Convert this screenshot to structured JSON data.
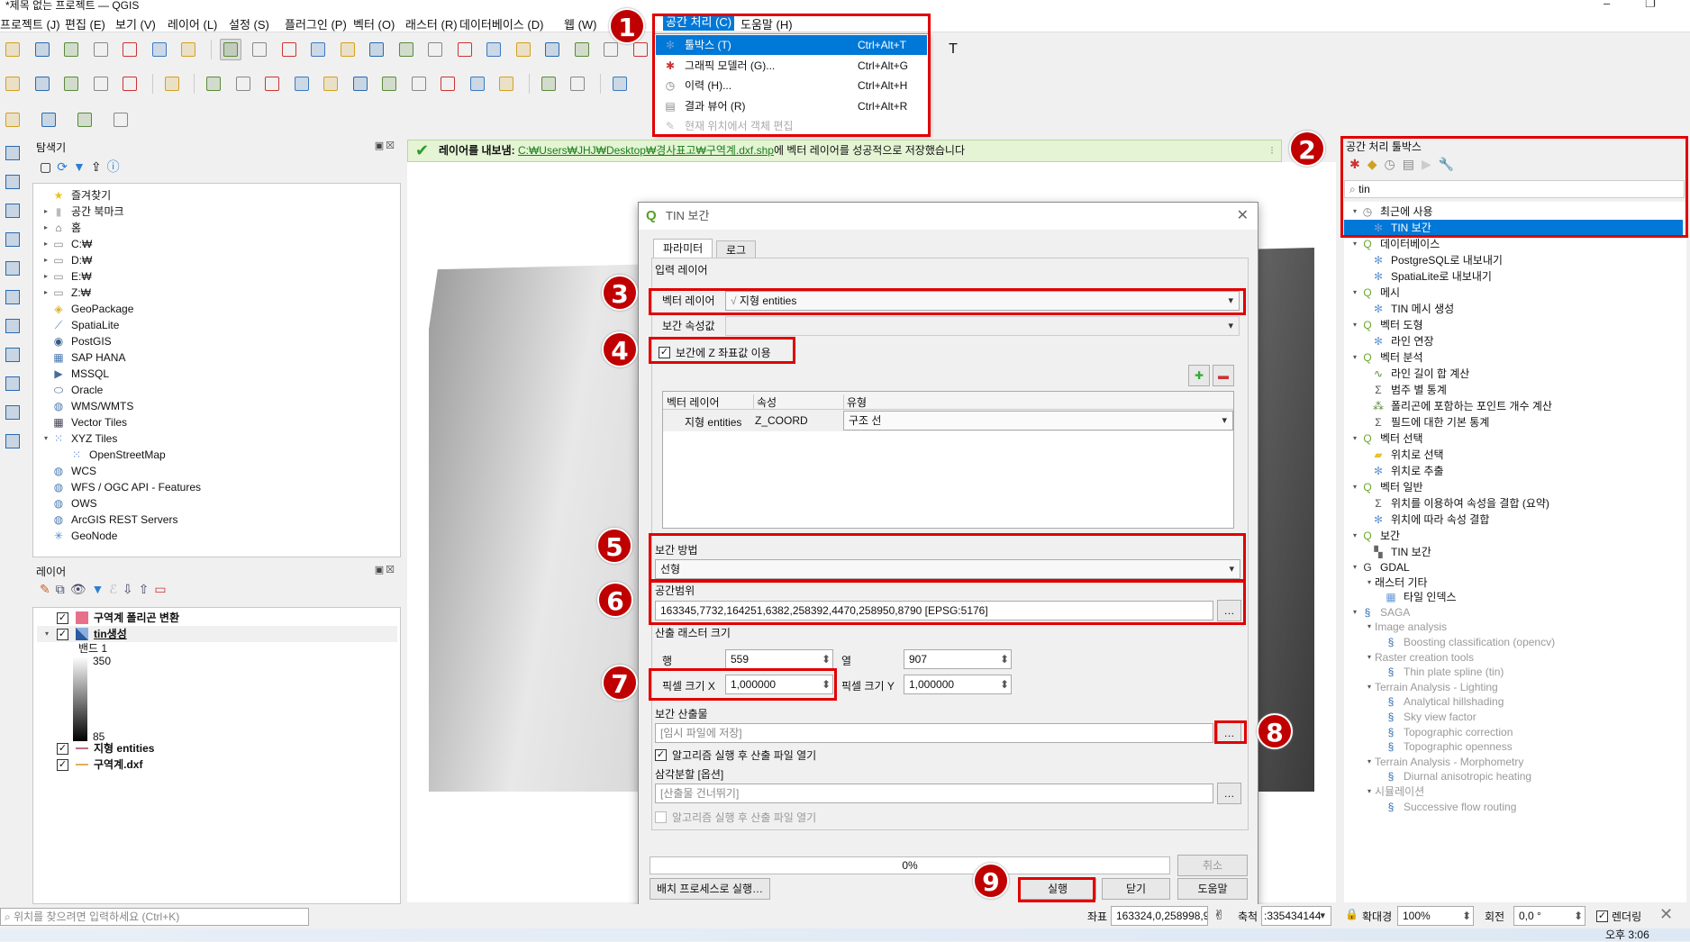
{
  "window": {
    "title": "*제목 없는 프로젝트 — QGIS",
    "minimize": "–",
    "maximize": "❐"
  },
  "menubar": [
    "프로젝트 (J)",
    "편집 (E)",
    "보기 (V)",
    "레이어 (L)",
    "설정 (S)",
    "플러그인 (P)",
    "벡터 (O)",
    "래스터 (R)",
    "데이터베이스 (D)",
    "웹 (W)",
    "공간 처리 (C)",
    "도움말 (H)"
  ],
  "processing_menu": [
    {
      "label": "툴박스 (T)",
      "shortcut": "Ctrl+Alt+T",
      "icon": "gear-icon",
      "state": "selected"
    },
    {
      "label": "그래픽 모델러 (G)...",
      "shortcut": "Ctrl+Alt+G",
      "icon": "model-icon",
      "state": "normal"
    },
    {
      "label": "이력 (H)...",
      "shortcut": "Ctrl+Alt+H",
      "icon": "clock-icon",
      "state": "normal"
    },
    {
      "label": "결과 뷰어 (R)",
      "shortcut": "Ctrl+Alt+R",
      "icon": "document-icon",
      "state": "normal"
    },
    {
      "label": "현재 위치에서 객체 편집",
      "shortcut": "",
      "icon": "edit-icon",
      "state": "disabled"
    }
  ],
  "toolbars": {
    "row1": [
      "new-project",
      "open-project",
      "save-project",
      "save-as",
      "print-layout",
      "layout-manager",
      "style-manager",
      "|",
      "pan",
      "pan-to-selection",
      "zoom-in",
      "zoom-out",
      "zoom-full",
      "zoom-selection",
      "zoom-layer",
      "zoom-native",
      "zoom-last",
      "zoom-next",
      "new-bookmark",
      "show-bookmarks",
      "new-map-view",
      "new-3d-view",
      "temporal-controller",
      "refresh"
    ],
    "row1b": [
      "text-annotation"
    ],
    "row2": [
      "data-source-manager",
      "new-geopackage-layer",
      "new-shapefile-layer",
      "new-spatialite-layer",
      "new-virtual-layer",
      "|",
      "digitize-layer",
      "|",
      "toggle-editing",
      "pencil",
      "save-edits",
      "add-feature",
      "vertex-tool",
      "delete-selected",
      "cut",
      "copy",
      "paste",
      "undo",
      "redo",
      "|",
      "label",
      "pin-label",
      "|",
      "help"
    ],
    "row3": [
      "select-features",
      "open-attribute-table",
      "deselect",
      "select-location"
    ]
  },
  "message_bar": {
    "prefix": "레이어를 내보냄:",
    "link": "C:₩Users₩JHJ₩Desktop₩경사표고₩구역계.dxf.shp",
    "suffix": "에 벡터 레이어를 성공적으로 저장했습니다",
    "status_color": "#2a9d2a"
  },
  "browser": {
    "title": "탐색기",
    "items": [
      {
        "label": "즐겨찾기",
        "icon": "star-icon",
        "arrow": ""
      },
      {
        "label": "공간 북마크",
        "icon": "bookmark-icon",
        "arrow": "▸"
      },
      {
        "label": "홈",
        "icon": "home-folder-icon",
        "arrow": "▸"
      },
      {
        "label": "C:₩",
        "icon": "folder-icon",
        "arrow": "▸"
      },
      {
        "label": "D:₩",
        "icon": "folder-icon",
        "arrow": "▸"
      },
      {
        "label": "E:₩",
        "icon": "folder-icon",
        "arrow": "▸"
      },
      {
        "label": "Z:₩",
        "icon": "folder-icon",
        "arrow": "▸"
      },
      {
        "label": "GeoPackage",
        "icon": "geopackage-icon",
        "arrow": ""
      },
      {
        "label": "SpatiaLite",
        "icon": "spatialite-icon",
        "arrow": ""
      },
      {
        "label": "PostGIS",
        "icon": "postgis-icon",
        "arrow": ""
      },
      {
        "label": "SAP HANA",
        "icon": "hana-icon",
        "arrow": ""
      },
      {
        "label": "MSSQL",
        "icon": "mssql-icon",
        "arrow": ""
      },
      {
        "label": "Oracle",
        "icon": "oracle-icon",
        "arrow": ""
      },
      {
        "label": "WMS/WMTS",
        "icon": "globe-icon",
        "arrow": ""
      },
      {
        "label": "Vector Tiles",
        "icon": "grid-icon",
        "arrow": ""
      },
      {
        "label": "XYZ Tiles",
        "icon": "tiles-icon",
        "arrow": "▾"
      },
      {
        "label": "OpenStreetMap",
        "icon": "tiles-icon",
        "arrow": "",
        "indent": 1
      },
      {
        "label": "WCS",
        "icon": "globe-icon",
        "arrow": ""
      },
      {
        "label": "WFS / OGC API - Features",
        "icon": "globe-icon",
        "arrow": ""
      },
      {
        "label": "OWS",
        "icon": "globe-icon",
        "arrow": ""
      },
      {
        "label": "ArcGIS REST Servers",
        "icon": "globe-icon",
        "arrow": ""
      },
      {
        "label": "GeoNode",
        "icon": "geonode-icon",
        "arrow": ""
      }
    ]
  },
  "layers": {
    "title": "레이어",
    "items": [
      {
        "label": "구역계 폴리곤 변환",
        "checked": true,
        "symbol": "#e8708a",
        "type": "fill"
      },
      {
        "label": "tin생성",
        "checked": true,
        "symbol": "raster",
        "type": "raster",
        "expanded": true
      },
      {
        "label": "지형 entities",
        "checked": true,
        "symbol": "#c07080",
        "type": "line"
      },
      {
        "label": "구역계.dxf",
        "checked": true,
        "symbol": "#e0b060",
        "type": "line"
      }
    ],
    "band_label": "밴드 1",
    "legend_max": "350",
    "legend_min": "85"
  },
  "locator": {
    "placeholder": "위치를 찾으려면 입력하세요 (Ctrl+K)"
  },
  "toolbox": {
    "title": "공간 처리 툴박스",
    "search": "tin",
    "rows": [
      {
        "label": "최근에 사용",
        "level": 0,
        "icon": "clock-icon"
      },
      {
        "label": "TIN 보간",
        "level": 1,
        "icon": "gear-icon",
        "selected": true
      },
      {
        "label": "데이터베이스",
        "level": 0,
        "icon": "qgis-icon"
      },
      {
        "label": "PostgreSQL로 내보내기",
        "level": 1,
        "icon": "gear-icon"
      },
      {
        "label": "SpatiaLite로 내보내기",
        "level": 1,
        "icon": "gear-icon"
      },
      {
        "label": "메시",
        "level": 0,
        "icon": "qgis-icon"
      },
      {
        "label": "TIN 메시 생성",
        "level": 1,
        "icon": "gear-icon"
      },
      {
        "label": "벡터 도형",
        "level": 0,
        "icon": "qgis-icon"
      },
      {
        "label": "라인 연장",
        "level": 1,
        "icon": "gear-icon"
      },
      {
        "label": "벡터 분석",
        "level": 0,
        "icon": "qgis-icon"
      },
      {
        "label": "라인 길이 합 계산",
        "level": 1,
        "icon": "line-length-icon"
      },
      {
        "label": "범주 별 통계",
        "level": 1,
        "icon": "sigma-icon"
      },
      {
        "label": "폴리곤에 포함하는 포인트 개수 계산",
        "level": 1,
        "icon": "count-points-icon"
      },
      {
        "label": "필드에 대한 기본 통계",
        "level": 1,
        "icon": "sigma-icon"
      },
      {
        "label": "벡터 선택",
        "level": 0,
        "icon": "qgis-icon"
      },
      {
        "label": "위치로 선택",
        "level": 1,
        "icon": "select-location-icon"
      },
      {
        "label": "위치로 추출",
        "level": 1,
        "icon": "gear-icon"
      },
      {
        "label": "벡터 일반",
        "level": 0,
        "icon": "qgis-icon"
      },
      {
        "label": "위치를 이용하여 속성을 결합 (요약)",
        "level": 1,
        "icon": "sigma-icon"
      },
      {
        "label": "위치에 따라 속성 결합",
        "level": 1,
        "icon": "gear-icon"
      },
      {
        "label": "보간",
        "level": 0,
        "icon": "qgis-icon"
      },
      {
        "label": "TIN 보간",
        "level": 1,
        "icon": "tin-icon"
      },
      {
        "label": "GDAL",
        "level": 0,
        "icon": "gdal-icon"
      },
      {
        "label": "래스터 기타",
        "level": 1,
        "icon": "",
        "group": true
      },
      {
        "label": "타일 인덱스",
        "level": 2,
        "icon": "tile-index-icon"
      },
      {
        "label": "SAGA",
        "level": 0,
        "icon": "saga-icon",
        "disabled": true
      },
      {
        "label": "Image analysis",
        "level": 1,
        "icon": "",
        "group": true,
        "disabled": true
      },
      {
        "label": "Boosting classification (opencv)",
        "level": 2,
        "icon": "saga-icon",
        "disabled": true
      },
      {
        "label": "Raster creation tools",
        "level": 1,
        "icon": "",
        "group": true,
        "disabled": true
      },
      {
        "label": "Thin plate spline (tin)",
        "level": 2,
        "icon": "saga-icon",
        "disabled": true
      },
      {
        "label": "Terrain Analysis - Lighting",
        "level": 1,
        "icon": "",
        "group": true,
        "disabled": true
      },
      {
        "label": "Analytical hillshading",
        "level": 2,
        "icon": "saga-icon",
        "disabled": true
      },
      {
        "label": "Sky view factor",
        "level": 2,
        "icon": "saga-icon",
        "disabled": true
      },
      {
        "label": "Topographic correction",
        "level": 2,
        "icon": "saga-icon",
        "disabled": true
      },
      {
        "label": "Topographic openness",
        "level": 2,
        "icon": "saga-icon",
        "disabled": true
      },
      {
        "label": "Terrain Analysis - Morphometry",
        "level": 1,
        "icon": "",
        "group": true,
        "disabled": true
      },
      {
        "label": "Diurnal anisotropic heating",
        "level": 2,
        "icon": "saga-icon",
        "disabled": true
      },
      {
        "label": "시뮬레이션",
        "level": 1,
        "icon": "",
        "group": true,
        "disabled": true
      },
      {
        "label": "Successive flow routing",
        "level": 2,
        "icon": "saga-icon",
        "disabled": true
      }
    ]
  },
  "dialog": {
    "title": "TIN 보간",
    "tabs": [
      "파라미터",
      "로그"
    ],
    "input_layers_label": "입력 레이어",
    "vector_layer_label": "벡터 레이어",
    "vector_layer_value": "지형 entities",
    "attr_label": "보간 속성값",
    "attr_value": "",
    "use_z_label": "보간에 Z 좌표값 이용",
    "use_z_checked": true,
    "table": {
      "headers": [
        "벡터 레이어",
        "속성",
        "유형"
      ],
      "rows": [
        [
          "지형 entities",
          "Z_COORD",
          "구조 선"
        ]
      ]
    },
    "method_label": "보간 방법",
    "method_value": "선형",
    "extent_label": "공간범위",
    "extent_value": "163345,7732,164251,6382,258392,4470,258950,8790 [EPSG:5176]",
    "raster_size_label": "산출 래스터 크기",
    "rows_label": "행",
    "rows_value": "559",
    "cols_label": "열",
    "cols_value": "907",
    "pixel_x_label": "픽셀 크기 X",
    "pixel_x_value": "1,000000",
    "pixel_y_label": "픽셀 크기 Y",
    "pixel_y_value": "1,000000",
    "output_label": "보간 산출물",
    "output_placeholder": "[임시 파일에 저장]",
    "open_output_label": "알고리즘 실행 후 산출 파일 열기",
    "open_output_checked": true,
    "triangulation_label": "삼각분할 [옵션]",
    "triangulation_placeholder": "[산출물 건너뛰기]",
    "open_tri_label": "알고리즘 실행 후 산출 파일 열기",
    "open_tri_checked": false,
    "browse": "…",
    "progress": 0,
    "progress_text": "0%",
    "cancel": "취소",
    "batch": "배치 프로세스로 실행…",
    "run": "실행",
    "close": "닫기",
    "help": "도움말"
  },
  "statusbar": {
    "coord_label": "좌표",
    "coord_value": "163324,0,258998,9",
    "scale_label": "축척",
    "scale_value": ":335434144",
    "magnifier_label": "확대경",
    "magnifier_value": "100%",
    "rotation_label": "회전",
    "rotation_value": "0,0 °",
    "render_label": "렌더링",
    "render_checked": true
  },
  "taskbar": {
    "clock": "오후 3:06"
  },
  "annotations": [
    "1",
    "2",
    "3",
    "4",
    "5",
    "6",
    "7",
    "8",
    "9"
  ],
  "colors": {
    "highlight": "#0078d7",
    "annotation": "#e00000",
    "message_bg": "#e4f4d4"
  }
}
